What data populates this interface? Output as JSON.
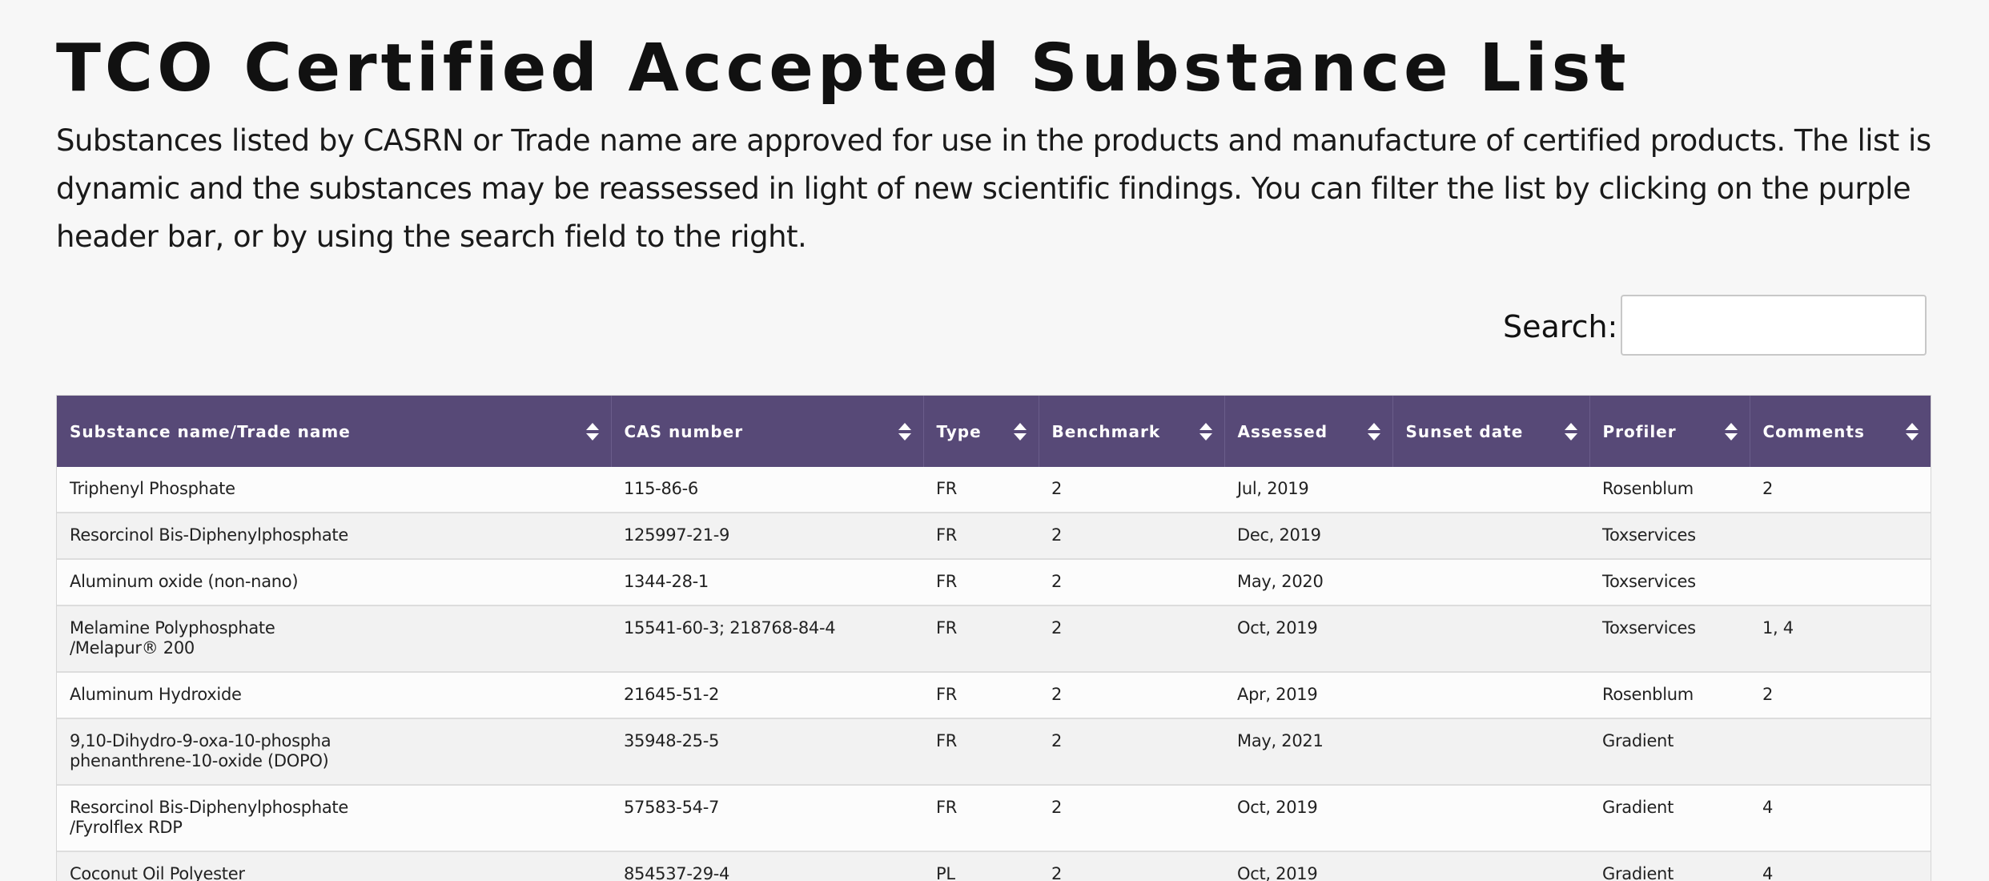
{
  "page": {
    "title": "TCO Certified Accepted Substance List",
    "intro": "Substances listed by CASRN or Trade name are approved for use in the products and manufacture of certified products. The list is dynamic and the substances may be reassessed in light of new scientific findings. You can filter the list by clicking on the purple header bar, or by using the search field to the right."
  },
  "search": {
    "label": "Search:",
    "value": "",
    "placeholder": ""
  },
  "table": {
    "header_color": "#574977",
    "columns": [
      {
        "key": "name",
        "label": "Substance name/Trade name"
      },
      {
        "key": "cas",
        "label": "CAS number"
      },
      {
        "key": "type",
        "label": "Type"
      },
      {
        "key": "benchmark",
        "label": "Benchmark"
      },
      {
        "key": "assessed",
        "label": "Assessed"
      },
      {
        "key": "sunset",
        "label": "Sunset date"
      },
      {
        "key": "profiler",
        "label": "Profiler"
      },
      {
        "key": "comments",
        "label": "Comments"
      }
    ],
    "rows": [
      {
        "name": [
          "Triphenyl Phosphate"
        ],
        "cas": "115-86-6",
        "type": "FR",
        "benchmark": "2",
        "assessed": "Jul, 2019",
        "sunset": "",
        "profiler": "Rosenblum",
        "comments": "2"
      },
      {
        "name": [
          "Resorcinol Bis-Diphenylphosphate"
        ],
        "cas": "125997-21-9",
        "type": "FR",
        "benchmark": "2",
        "assessed": "Dec, 2019",
        "sunset": "",
        "profiler": "Toxservices",
        "comments": ""
      },
      {
        "name": [
          "Aluminum oxide (non-nano)"
        ],
        "cas": "1344-28-1",
        "type": "FR",
        "benchmark": "2",
        "assessed": "May, 2020",
        "sunset": "",
        "profiler": "Toxservices",
        "comments": ""
      },
      {
        "name": [
          "Melamine Polyphosphate",
          "/Melapur® 200"
        ],
        "cas": "15541-60-3; 218768-84-4",
        "type": "FR",
        "benchmark": "2",
        "assessed": "Oct, 2019",
        "sunset": "",
        "profiler": "Toxservices",
        "comments": "1, 4"
      },
      {
        "name": [
          "Aluminum Hydroxide"
        ],
        "cas": "21645-51-2",
        "type": "FR",
        "benchmark": "2",
        "assessed": "Apr, 2019",
        "sunset": "",
        "profiler": "Rosenblum",
        "comments": "2"
      },
      {
        "name": [
          "9,10-Dihydro-9-oxa-10-phospha",
          "phenanthrene-10-oxide (DOPO)"
        ],
        "cas": "35948-25-5",
        "type": "FR",
        "benchmark": "2",
        "assessed": "May, 2021",
        "sunset": "",
        "profiler": "Gradient",
        "comments": ""
      },
      {
        "name": [
          "Resorcinol Bis-Diphenylphosphate",
          "/Fyrolflex RDP"
        ],
        "cas": "57583-54-7",
        "type": "FR",
        "benchmark": "2",
        "assessed": "Oct, 2019",
        "sunset": "",
        "profiler": "Gradient",
        "comments": "4"
      },
      {
        "name": [
          "Coconut Oil Polyester"
        ],
        "cas": "854537-29-4",
        "type": "PL",
        "benchmark": "2",
        "assessed": "Oct, 2019",
        "sunset": "",
        "profiler": "Gradient",
        "comments": "4"
      }
    ]
  }
}
